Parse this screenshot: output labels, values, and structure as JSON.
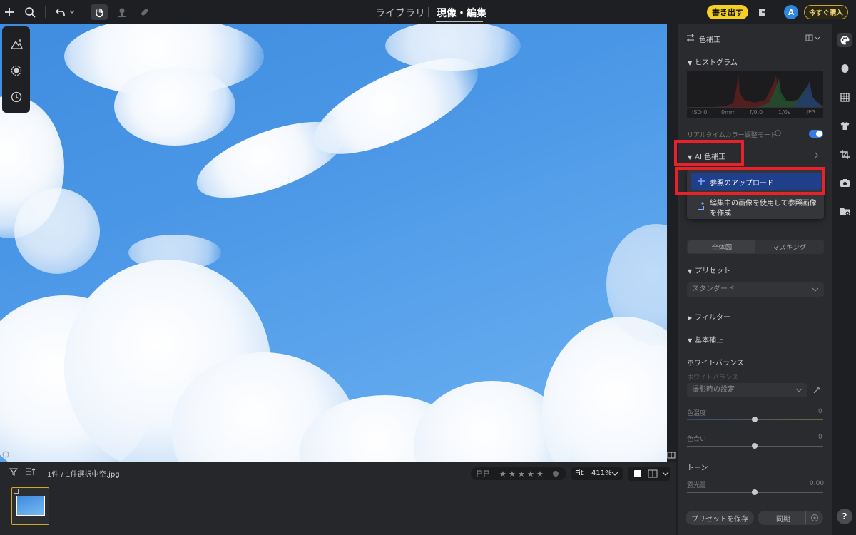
{
  "toolbar": {
    "add_icon": "plus-icon",
    "search_icon": "search-icon",
    "undo_icon": "undo-icon",
    "hand_icon": "hand-icon",
    "stamp_icon": "stamp-icon",
    "bandage_icon": "bandage-icon"
  },
  "nav": {
    "tabs": [
      {
        "label": "ライブラリ",
        "active": false
      },
      {
        "label": "現像・編集",
        "active": true
      }
    ]
  },
  "header_right": {
    "export_label": "書き出す",
    "avatar_initial": "A",
    "buy_label": "今すぐ購入",
    "accent_color": "#f5d020"
  },
  "filmstrip": {
    "count_text": "1件 / 1件選択中",
    "filename": "空.jpg",
    "fit_label": "Fit",
    "zoom_text": "411%",
    "stars": [
      "★",
      "★",
      "★",
      "★",
      "★"
    ]
  },
  "panel": {
    "title": "色補正",
    "histogram_label": "ヒストグラム",
    "hist_info": [
      "ISO 0",
      "0mm",
      "f/0.0",
      "1/0s",
      "JPG"
    ],
    "realtime_label": "リアルタイムカラー調整モード",
    "realtime_on": true,
    "ai_label": "AI 色補正",
    "menu": {
      "upload_label": "参照のアップロード",
      "create_line1": "編集中の画像を使用して参照画像",
      "create_line2": "を作成"
    },
    "segments": [
      "全体図",
      "マスキング"
    ],
    "preset_label": "プリセット",
    "preset_value": "スタンダード",
    "filter_label": "フィルター",
    "basic_label": "基本補正",
    "wb_heading": "ホワイトバランス",
    "wb_sub": "ホワイトバランス",
    "wb_value": "撮影時の設定",
    "temp_label": "色温度",
    "temp_value": "0",
    "tint_label": "色合い",
    "tint_value": "0",
    "tone_heading": "トーン",
    "exposure_label": "露光量",
    "exposure_value": "0.00",
    "save_preset": "プリセットを保存",
    "sync": "同期"
  },
  "rail": {
    "icons": [
      "palette-icon",
      "face-icon",
      "texture-icon",
      "shirt-icon",
      "crop-icon",
      "camera-icon",
      "folder-icon"
    ],
    "help_label": "?"
  }
}
